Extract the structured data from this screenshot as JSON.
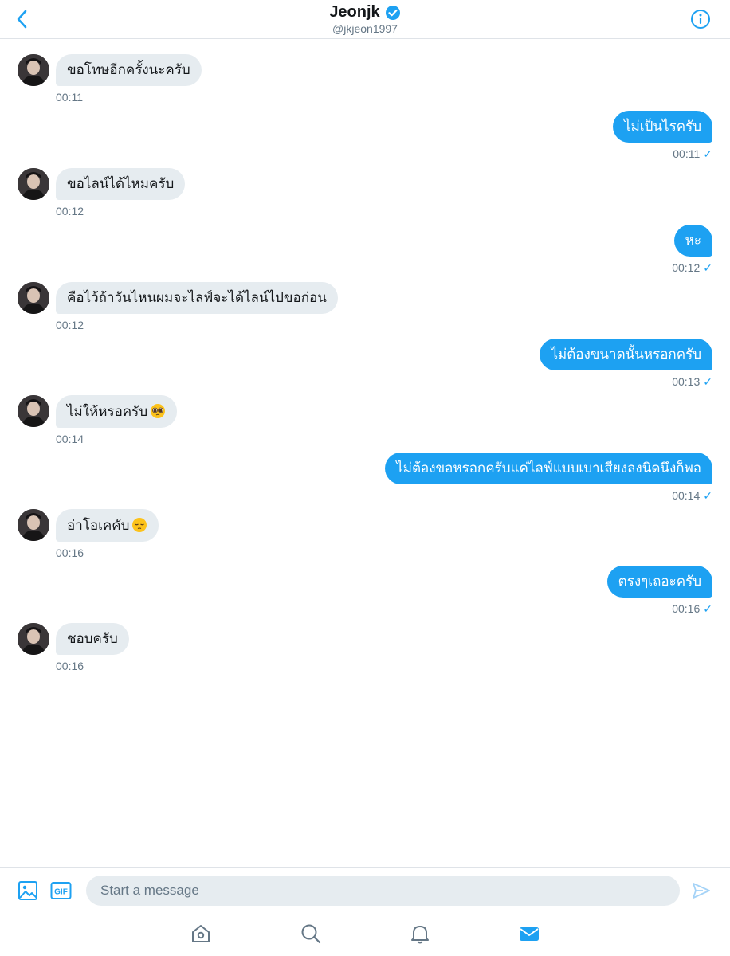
{
  "header": {
    "title": "Jeonjk",
    "handle": "@jkjeon1997",
    "verified": true
  },
  "colors": {
    "accent": "#1da1f2",
    "bubble_in": "#e6ecf0",
    "muted": "#657786"
  },
  "messages": [
    {
      "side": "in",
      "text": "ขอโทษอีกครั้งนะครับ",
      "time": "00:11"
    },
    {
      "side": "out",
      "text": "ไม่เป็นไรครับ",
      "time": "00:11"
    },
    {
      "side": "in",
      "text": "ขอไลน์ได้ไหมครับ",
      "time": "00:12"
    },
    {
      "side": "out",
      "text": "หะ",
      "time": "00:12"
    },
    {
      "side": "in",
      "text": "คือไว้ถ้าวันไหนผมจะไลฟ์จะได้ไลน์ไปขอก่อน",
      "time": "00:12"
    },
    {
      "side": "out",
      "text": "ไม่ต้องขนาดนั้นหรอกครับ",
      "time": "00:13"
    },
    {
      "side": "in",
      "text": "ไม่ให้หรอครับ",
      "emoji": "pleading-face",
      "time": "00:14"
    },
    {
      "side": "out",
      "text": "ไม่ต้องขอหรอกครับแค่ไลฟ์แบบเบาเสียงลงนิดนึงก็พอ",
      "time": "00:14"
    },
    {
      "side": "in",
      "text": "อ่าโอเคคับ",
      "emoji": "pensive-face",
      "time": "00:16"
    },
    {
      "side": "out",
      "text": "ตรงๆเถอะครับ",
      "time": "00:16"
    },
    {
      "side": "in",
      "text": "ชอบครับ",
      "time": "00:16"
    }
  ],
  "composer": {
    "placeholder": "Start a message",
    "image_icon": "image-icon",
    "gif_label": "GIF",
    "send_icon": "send-icon"
  },
  "tabbar": {
    "items": [
      "home-icon",
      "search-icon",
      "bell-icon",
      "mail-icon"
    ],
    "active": "mail-icon"
  }
}
